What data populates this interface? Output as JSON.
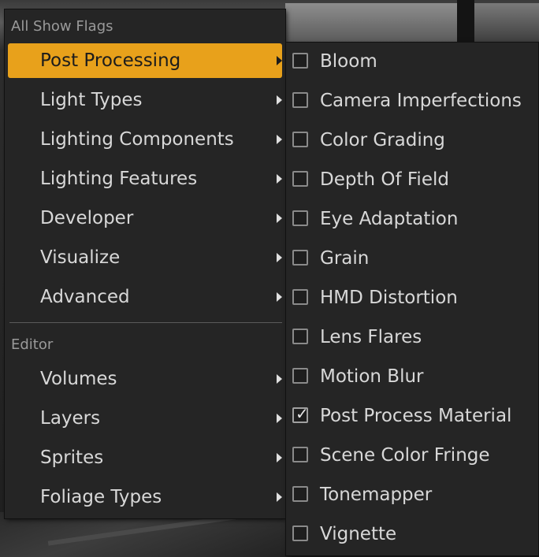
{
  "main_menu": {
    "header": "All Show Flags",
    "items": [
      {
        "label": "Post Processing"
      },
      {
        "label": "Light Types"
      },
      {
        "label": "Lighting Components"
      },
      {
        "label": "Lighting Features"
      },
      {
        "label": "Developer"
      },
      {
        "label": "Visualize"
      },
      {
        "label": "Advanced"
      }
    ],
    "editor_header": "Editor",
    "editor_items": [
      {
        "label": "Volumes"
      },
      {
        "label": "Layers"
      },
      {
        "label": "Sprites"
      },
      {
        "label": "Foliage Types"
      }
    ],
    "active_item": "Post Processing",
    "accent_color": "#e8a11b"
  },
  "submenu": {
    "items": [
      {
        "label": "Bloom",
        "checked": false
      },
      {
        "label": "Camera Imperfections",
        "checked": false
      },
      {
        "label": "Color Grading",
        "checked": false
      },
      {
        "label": "Depth Of Field",
        "checked": false
      },
      {
        "label": "Eye Adaptation",
        "checked": false
      },
      {
        "label": "Grain",
        "checked": false
      },
      {
        "label": "HMD Distortion",
        "checked": false
      },
      {
        "label": "Lens Flares",
        "checked": false
      },
      {
        "label": "Motion Blur",
        "checked": false
      },
      {
        "label": "Post Process Material",
        "checked": true
      },
      {
        "label": "Scene Color Fringe",
        "checked": false
      },
      {
        "label": "Tonemapper",
        "checked": false
      },
      {
        "label": "Vignette",
        "checked": false
      }
    ],
    "checkmark_glyph": "✓"
  }
}
